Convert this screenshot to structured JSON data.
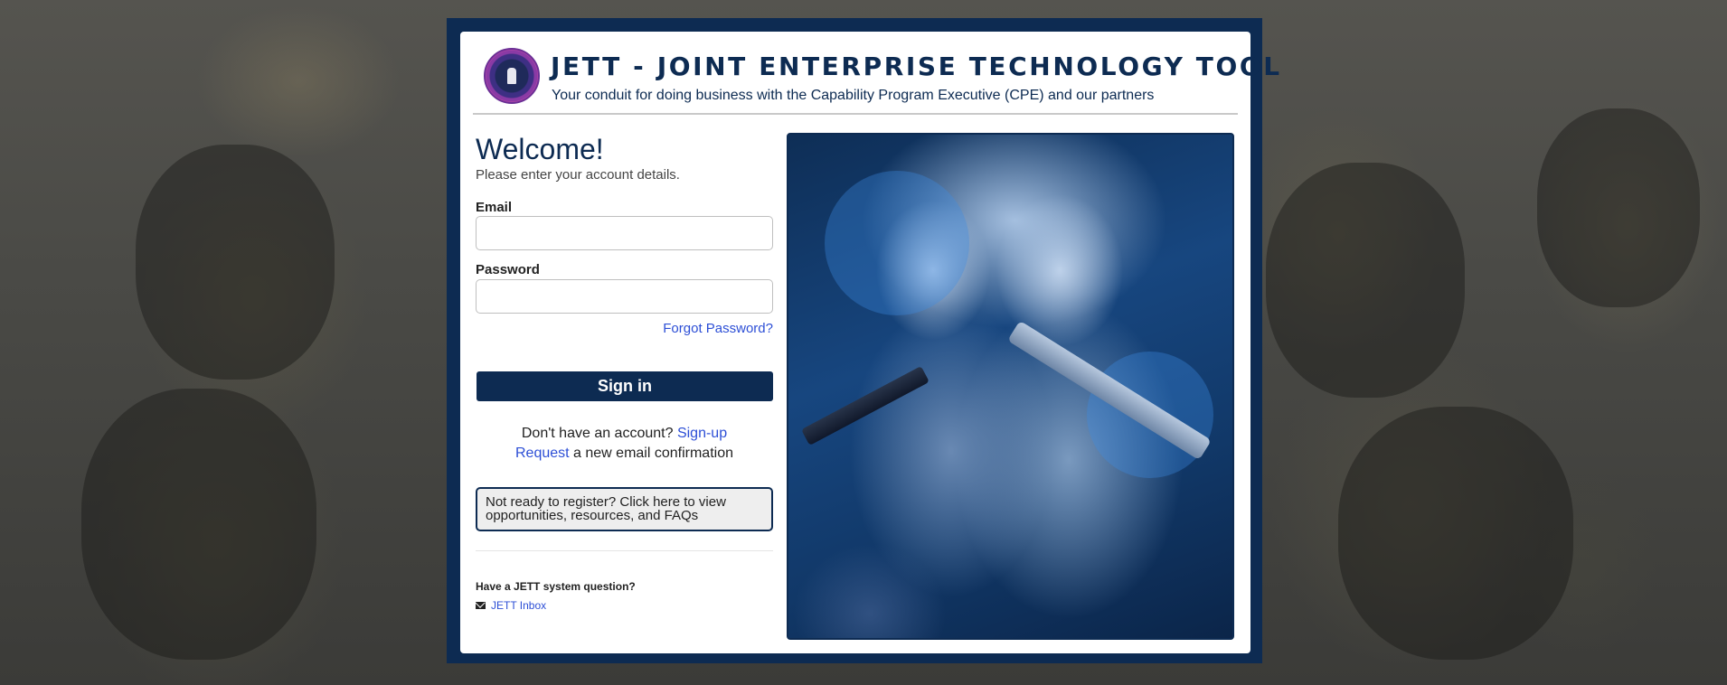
{
  "header": {
    "title": "JETT - JOINT ENTERPRISE TECHNOLOGY TOOL",
    "subtitle": "Your conduit for doing business with the Capability Program Executive (CPE) and our partners",
    "logo_icon": "cpe-seal-icon"
  },
  "login": {
    "heading": "Welcome!",
    "subheading": "Please enter your account details.",
    "email_label": "Email",
    "email_value": "",
    "password_label": "Password",
    "password_value": "",
    "forgot_link": "Forgot Password?",
    "signin_label": "Sign in",
    "signup_prompt": "Don't have an account?",
    "signup_link": "Sign-up",
    "request_link": "Request",
    "request_suffix": " a new email confirmation",
    "not_ready_label": "Not ready to register? Click here to view opportunities, resources, and FAQs"
  },
  "support": {
    "question": "Have a JETT system question?",
    "inbox_link": "JETT Inbox",
    "inbox_icon": "envelope-icon"
  },
  "colors": {
    "brand_navy": "#0d2b52",
    "link_blue": "#2d4fd6"
  }
}
